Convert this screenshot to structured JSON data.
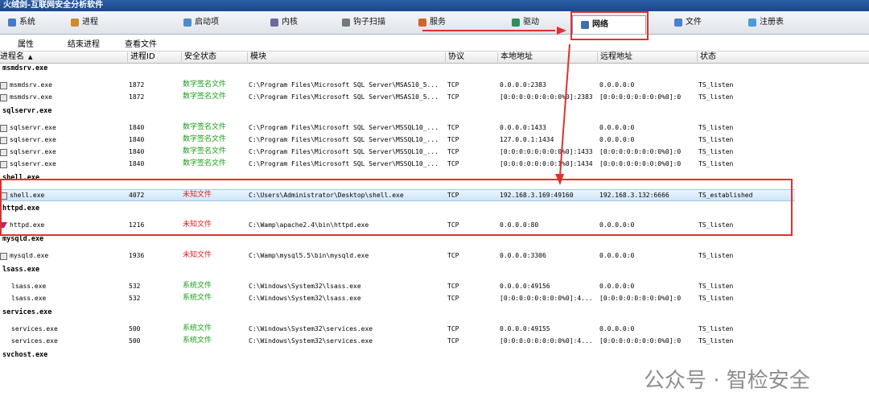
{
  "app": {
    "title": "火绒剑-互联网安全分析软件"
  },
  "tabs": [
    {
      "label": "系统",
      "icon": "system-icon",
      "color": "#4a79c4"
    },
    {
      "label": "进程",
      "icon": "process-icon",
      "color": "#d08a2c"
    },
    {
      "label": "启动项",
      "icon": "startup-icon",
      "color": "#4c8dc9"
    },
    {
      "label": "内核",
      "icon": "kernel-icon",
      "color": "#6b6b9e"
    },
    {
      "label": "钩子扫描",
      "icon": "hook-icon",
      "color": "#777777"
    },
    {
      "label": "服务",
      "icon": "service-icon",
      "color": "#d0662c"
    },
    {
      "label": "驱动",
      "icon": "driver-icon",
      "color": "#2f8f5a"
    },
    {
      "label": "网络",
      "icon": "network-icon",
      "color": "#3a6fb0"
    },
    {
      "label": "文件",
      "icon": "file-icon",
      "color": "#4a7fd0"
    },
    {
      "label": "注册表",
      "icon": "registry-icon",
      "color": "#4c9ad8"
    }
  ],
  "toolbar": {
    "properties": "属性",
    "end_process": "结束进程",
    "view_file": "查看文件"
  },
  "columns": [
    "进程名",
    "进程ID",
    "安全状态",
    "模块",
    "协议",
    "本地地址",
    "远程地址",
    "状态"
  ],
  "sort_indicator": "▲",
  "colors": {
    "signed": "#1a9e1a",
    "unknown": "#e02020",
    "system": "#1a9e1a",
    "highlight": "#e03030"
  },
  "groups": [
    {
      "name": "msmdsrv.exe",
      "rows": [
        {
          "proc": "msmdsrv.exe",
          "pid": "1872",
          "status": "数字签名文件",
          "st": "signed",
          "module": "C:\\Program Files\\Microsoft SQL Server\\MSAS10_5...",
          "proto": "TCP",
          "local": "0.0.0.0:2383",
          "remote": "0.0.0.0:0",
          "state": "TS_listen"
        },
        {
          "proc": "msmdsrv.exe",
          "pid": "1872",
          "status": "数字签名文件",
          "st": "signed",
          "module": "C:\\Program Files\\Microsoft SQL Server\\MSAS10_5...",
          "proto": "TCP",
          "local": "[0:0:0:0:0:0:0:0%0]:2383",
          "remote": "[0:0:0:0:0:0:0:0%0]:0",
          "state": "TS_listen"
        }
      ]
    },
    {
      "name": "sqlservr.exe",
      "rows": [
        {
          "proc": "sqlservr.exe",
          "pid": "1840",
          "status": "数字签名文件",
          "st": "signed",
          "module": "C:\\Program Files\\Microsoft SQL Server\\MSSQL10_...",
          "proto": "TCP",
          "local": "0.0.0.0:1433",
          "remote": "0.0.0.0:0",
          "state": "TS_listen"
        },
        {
          "proc": "sqlservr.exe",
          "pid": "1840",
          "status": "数字签名文件",
          "st": "signed",
          "module": "C:\\Program Files\\Microsoft SQL Server\\MSSQL10_...",
          "proto": "TCP",
          "local": "127.0.0.1:1434",
          "remote": "0.0.0.0:0",
          "state": "TS_listen"
        },
        {
          "proc": "sqlservr.exe",
          "pid": "1840",
          "status": "数字签名文件",
          "st": "signed",
          "module": "C:\\Program Files\\Microsoft SQL Server\\MSSQL10_...",
          "proto": "TCP",
          "local": "[0:0:0:0:0:0:0:0%0]:1433",
          "remote": "[0:0:0:0:0:0:0:0%0]:0",
          "state": "TS_listen"
        },
        {
          "proc": "sqlservr.exe",
          "pid": "1840",
          "status": "数字签名文件",
          "st": "signed",
          "module": "C:\\Program Files\\Microsoft SQL Server\\MSSQL10_...",
          "proto": "TCP",
          "local": "[0:0:0:0:0:0:0:1%0]:1434",
          "remote": "[0:0:0:0:0:0:0:0%0]:0",
          "state": "TS_listen"
        }
      ]
    },
    {
      "name": "shell.exe",
      "rows": [
        {
          "proc": "shell.exe",
          "pid": "4072",
          "status": "未知文件",
          "st": "unknown",
          "module": "C:\\Users\\Administrator\\Desktop\\shell.exe",
          "proto": "TCP",
          "local": "192.168.3.169:49160",
          "remote": "192.168.3.132:6666",
          "state": "TS_established",
          "selected": true
        }
      ]
    },
    {
      "name": "httpd.exe",
      "rows": [
        {
          "proc": "httpd.exe",
          "pid": "1216",
          "status": "未知文件",
          "st": "unknown",
          "module": "C:\\Wamp\\apache2.4\\bin\\httpd.exe",
          "proto": "TCP",
          "local": "0.0.0.0:80",
          "remote": "0.0.0.0:0",
          "state": "TS_listen"
        }
      ]
    },
    {
      "name": "mysqld.exe",
      "rows": [
        {
          "proc": "mysqld.exe",
          "pid": "1936",
          "status": "未知文件",
          "st": "unknown",
          "module": "C:\\Wamp\\mysql5.5\\bin\\mysqld.exe",
          "proto": "TCP",
          "local": "0.0.0.0:3306",
          "remote": "0.0.0.0:0",
          "state": "TS_listen"
        }
      ]
    },
    {
      "name": "lsass.exe",
      "rows": [
        {
          "proc": "lsass.exe",
          "pid": "532",
          "status": "系统文件",
          "st": "system",
          "module": "C:\\Windows\\System32\\lsass.exe",
          "proto": "TCP",
          "local": "0.0.0.0:49156",
          "remote": "0.0.0.0:0",
          "state": "TS_listen"
        },
        {
          "proc": "lsass.exe",
          "pid": "532",
          "status": "系统文件",
          "st": "system",
          "module": "C:\\Windows\\System32\\lsass.exe",
          "proto": "TCP",
          "local": "[0:0:0:0:0:0:0:0%0]:4...",
          "remote": "[0:0:0:0:0:0:0:0%0]:0",
          "state": "TS_listen"
        }
      ]
    },
    {
      "name": "services.exe",
      "rows": [
        {
          "proc": "services.exe",
          "pid": "500",
          "status": "系统文件",
          "st": "system",
          "module": "C:\\Windows\\System32\\services.exe",
          "proto": "TCP",
          "local": "0.0.0.0:49155",
          "remote": "0.0.0.0:0",
          "state": "TS_listen"
        },
        {
          "proc": "services.exe",
          "pid": "500",
          "status": "系统文件",
          "st": "system",
          "module": "C:\\Windows\\System32\\services.exe",
          "proto": "TCP",
          "local": "[0:0:0:0:0:0:0:0%0]:4...",
          "remote": "[0:0:0:0:0:0:0:0%0]:0",
          "state": "TS_listen"
        }
      ]
    },
    {
      "name": "svchost.exe",
      "rows": []
    }
  ],
  "watermark": "公众号 · 智检安全"
}
